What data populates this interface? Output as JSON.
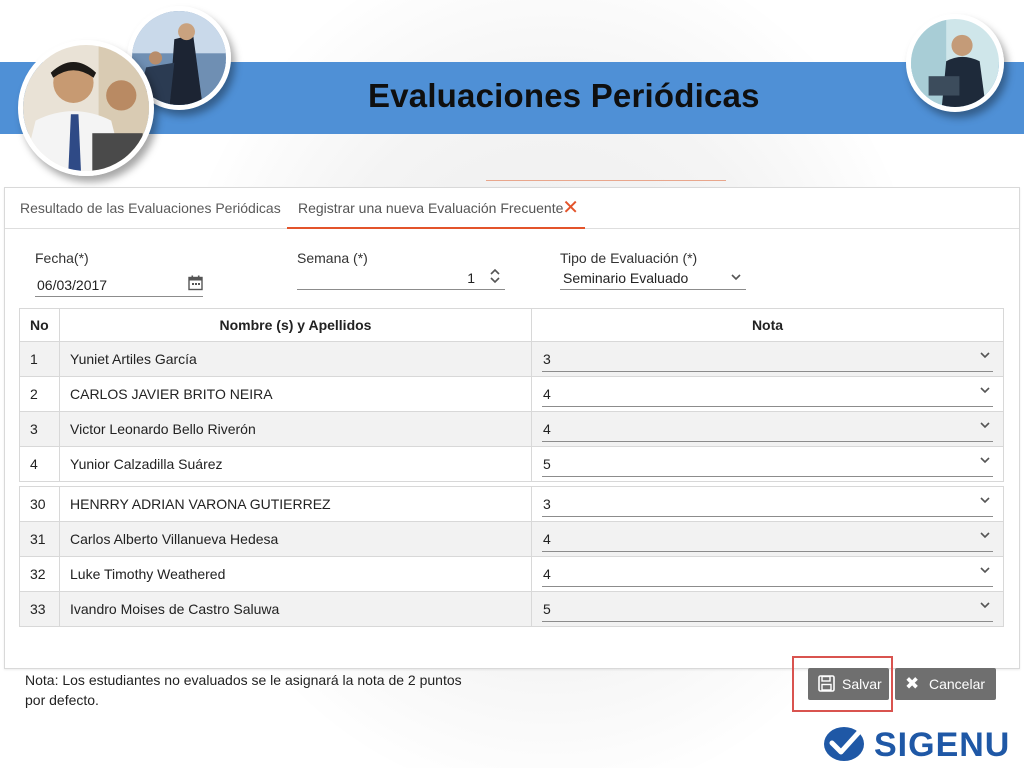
{
  "slide_title": "Evaluaciones Periódicas",
  "tabs": [
    {
      "label": "Resultado de las Evaluaciones Periódicas"
    },
    {
      "label": "Registrar una nueva Evaluación Frecuente"
    }
  ],
  "form": {
    "fecha_label": "Fecha(*)",
    "fecha_value": "06/03/2017",
    "semana_label": "Semana (*)",
    "semana_value": "1",
    "tipo_label": "Tipo de Evaluación (*)",
    "tipo_value": "Seminario Evaluado"
  },
  "table": {
    "headers": [
      "No",
      "Nombre (s) y Apellidos",
      "Nota"
    ],
    "rows_top": [
      {
        "no": "1",
        "name": "Yuniet Artiles García",
        "nota": "3"
      },
      {
        "no": "2",
        "name": "CARLOS JAVIER BRITO NEIRA",
        "nota": "4"
      },
      {
        "no": "3",
        "name": "Victor Leonardo Bello Riverón",
        "nota": "4"
      },
      {
        "no": "4",
        "name": "Yunior Calzadilla Suárez",
        "nota": "5"
      }
    ],
    "rows_bottom": [
      {
        "no": "30",
        "name": "HENRRY ADRIAN VARONA GUTIERREZ",
        "nota": "3"
      },
      {
        "no": "31",
        "name": "Carlos Alberto Villanueva Hedesa",
        "nota": "4"
      },
      {
        "no": "32",
        "name": "Luke Timothy Weathered",
        "nota": "4"
      },
      {
        "no": "33",
        "name": "Ivandro Moises de Castro Saluwa",
        "nota": "5"
      }
    ]
  },
  "note": "Nota: Los estudiantes no evaluados se le asignará la nota de 2 puntos por defecto.",
  "buttons": {
    "save": "Salvar",
    "cancel": "Cancelar"
  },
  "logo_text": "SIGENU",
  "colors": {
    "band": "#4f90d6",
    "accent": "#e3542b",
    "button": "#6f6f6f",
    "highlight": "#d9534f",
    "logo": "#1f58a6"
  }
}
